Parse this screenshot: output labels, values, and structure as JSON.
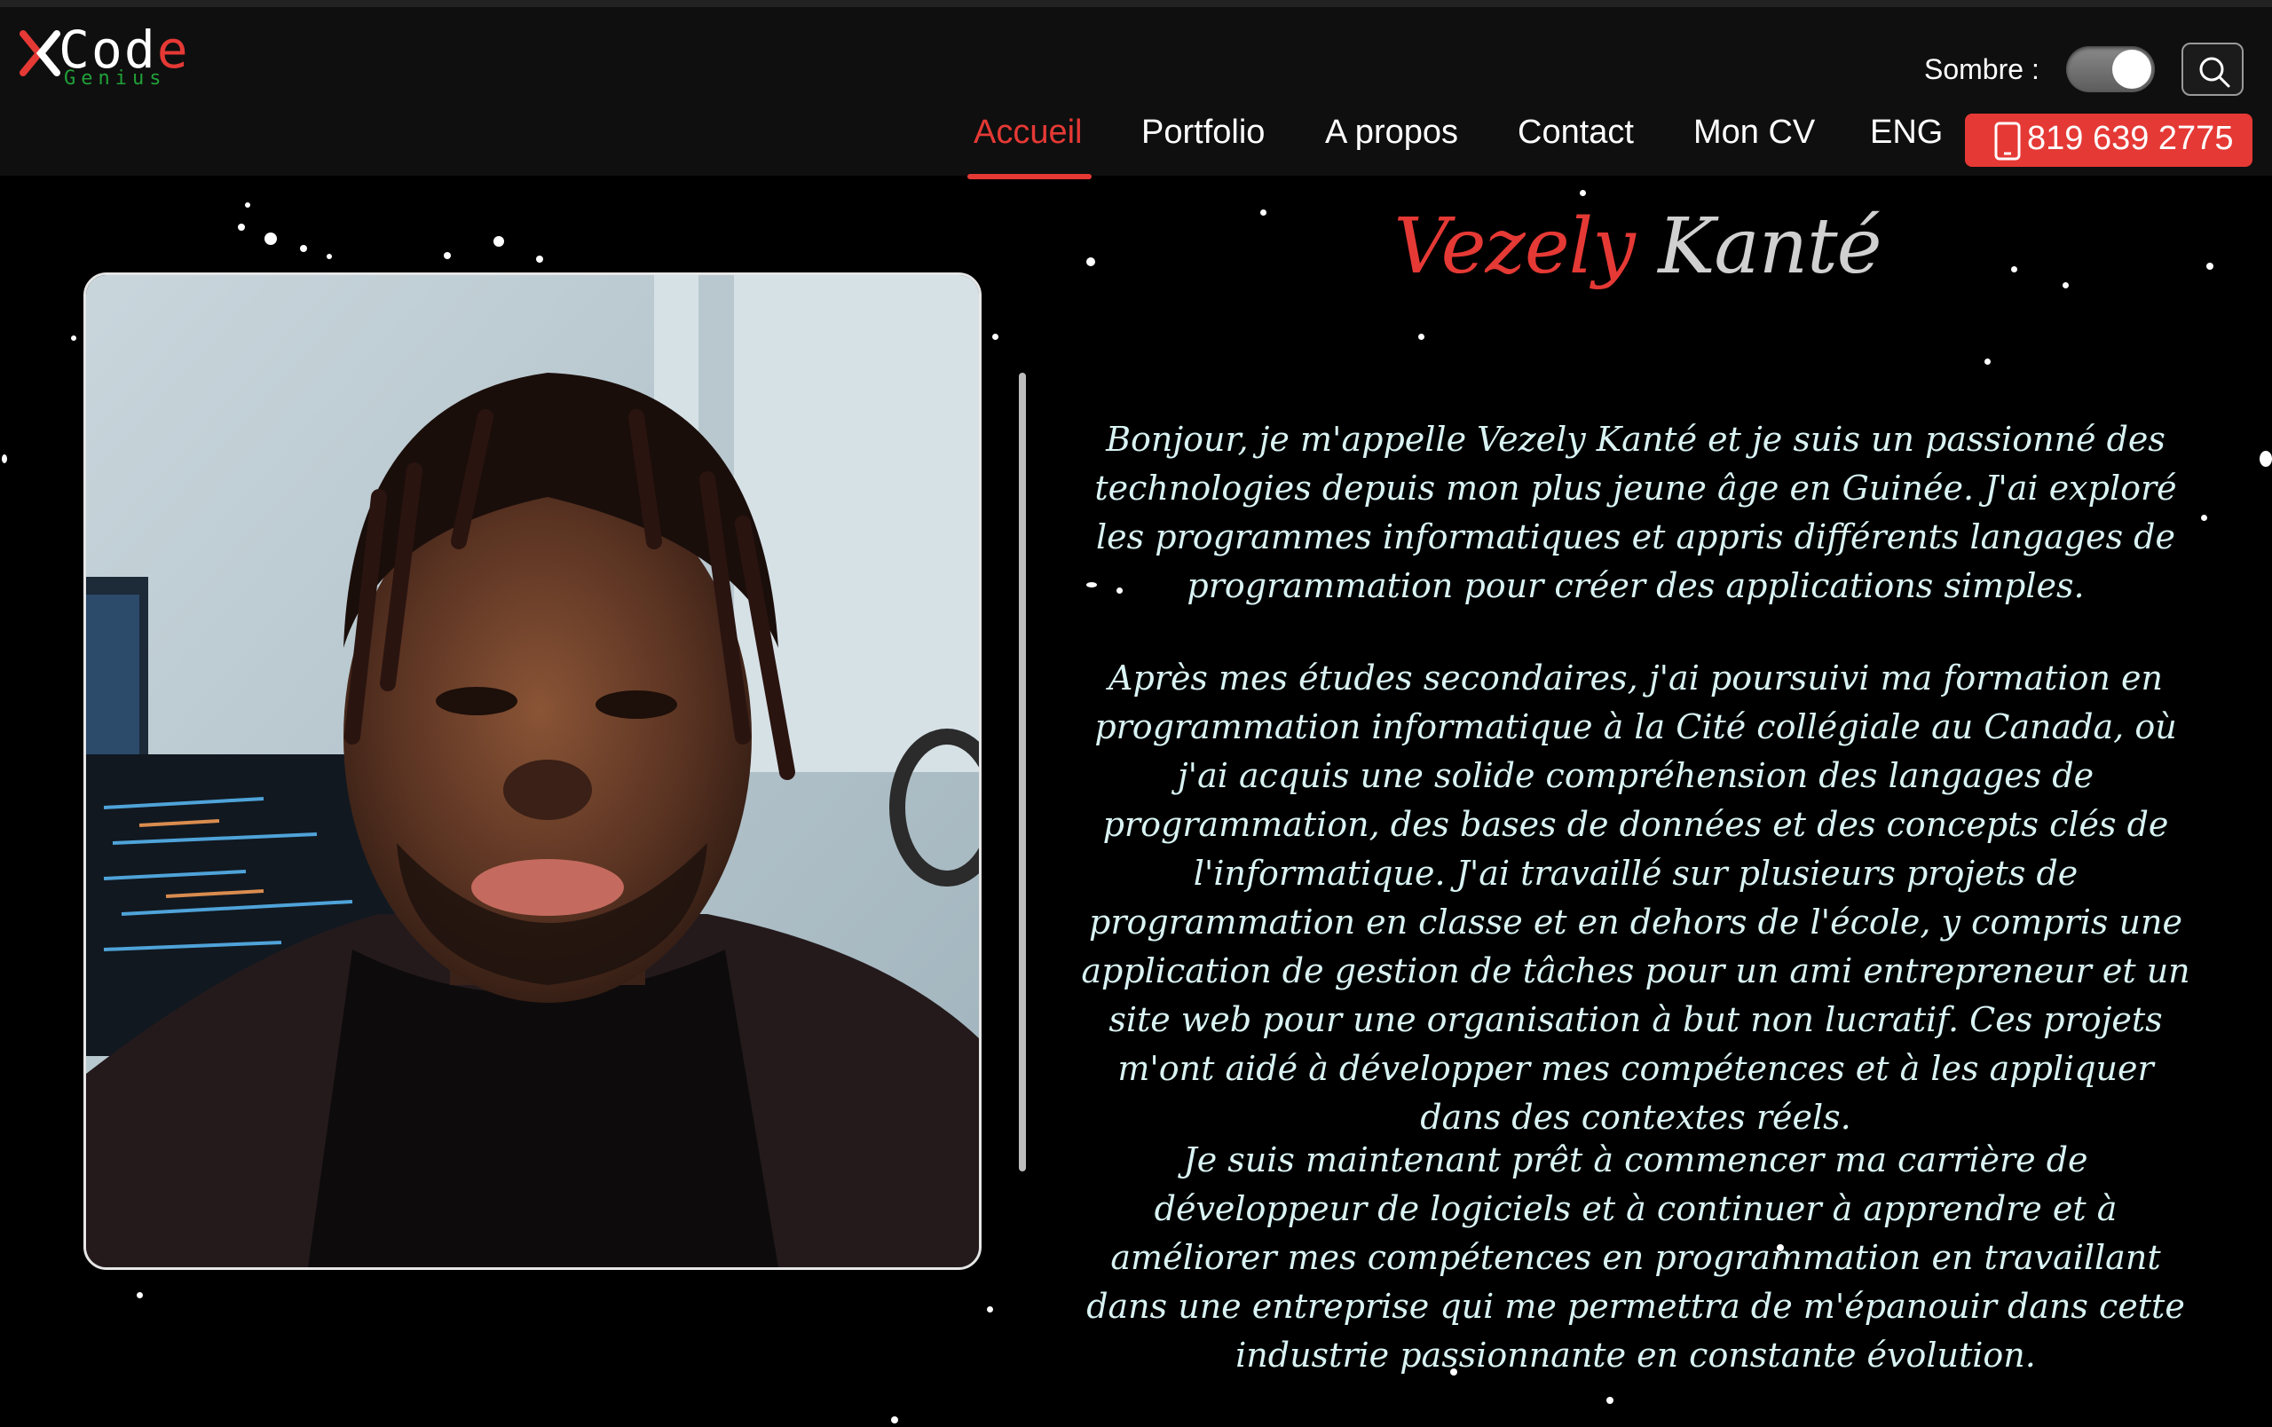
{
  "brand": {
    "logo_word": "Cod",
    "logo_word_accent": "e",
    "logo_sub": "Genius",
    "colors": {
      "accent": "#e53935",
      "green": "#21a038",
      "background": "#000000",
      "header": "#0f0f0f"
    }
  },
  "header": {
    "theme_label": "Sombre :",
    "theme_toggle_on": true,
    "search_icon": "search-icon"
  },
  "nav": {
    "items": [
      {
        "label": "Accueil",
        "active": true
      },
      {
        "label": "Portfolio",
        "active": false
      },
      {
        "label": "A propos",
        "active": false
      },
      {
        "label": "Contact",
        "active": false
      },
      {
        "label": "Mon CV",
        "active": false
      },
      {
        "label": "ENG",
        "active": false
      }
    ],
    "phone": "819 639 2775",
    "phone_icon": "phone-icon"
  },
  "hero": {
    "photo_alt": "portrait-photo",
    "name_first": "Vezely",
    "name_last": "Kanté",
    "paragraphs": [
      "Bonjour, je m'appelle Vezely Kanté et je suis un passionné des technologies depuis mon plus jeune âge en Guinée. J'ai exploré les programmes informatiques et appris différents langages de programmation pour créer des applications simples.",
      "Après mes études secondaires, j'ai poursuivi ma formation en programmation informatique à la Cité collégiale au Canada, où j'ai acquis une solide compréhension des langages de programmation, des bases de données et des concepts clés de l'informatique. J'ai travaillé sur plusieurs projets de programmation en classe et en dehors de l'école, y compris une application de gestion de tâches pour un ami entrepreneur et un site web pour une organisation à but non lucratif. Ces projets m'ont aidé à développer mes compétences et à les appliquer dans des contextes réels.",
      "Je suis maintenant prêt à commencer ma carrière de développeur de logiciels et à continuer à apprendre et à améliorer mes compétences en programmation en travaillant dans une entreprise qui me permettra de m'épanouir dans cette industrie passionnante en constante évolution."
    ]
  }
}
